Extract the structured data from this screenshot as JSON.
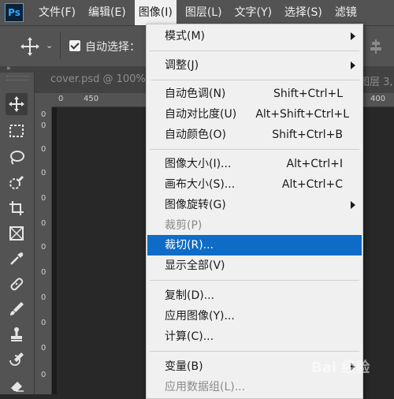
{
  "app": {
    "logo": "Ps"
  },
  "menubar": {
    "items": [
      {
        "label": "文件(F)"
      },
      {
        "label": "编辑(E)"
      },
      {
        "label": "图像(I)"
      },
      {
        "label": "图层(L)"
      },
      {
        "label": "文字(Y)"
      },
      {
        "label": "选择(S)"
      },
      {
        "label": "滤镜"
      }
    ]
  },
  "options": {
    "auto_select_label": "自动选择："
  },
  "document": {
    "tab_label": "cover.psd @ 100%",
    "tab_right_label": "图层 3,",
    "ruler_top": [
      "0",
      "450",
      "400"
    ],
    "ruler_left": [
      "0",
      "0",
      "0",
      "0",
      "0",
      "0",
      "0",
      "0",
      "0",
      "0",
      "0",
      "0"
    ]
  },
  "image_menu": {
    "items": [
      {
        "label": "模式(M)",
        "shortcut": ""
      },
      {
        "label": "调整(J)",
        "shortcut": ""
      },
      {
        "label": "自动色调(N)",
        "shortcut": "Shift+Ctrl+L"
      },
      {
        "label": "自动对比度(U)",
        "shortcut": "Alt+Shift+Ctrl+L"
      },
      {
        "label": "自动颜色(O)",
        "shortcut": "Shift+Ctrl+B"
      },
      {
        "label": "图像大小(I)...",
        "shortcut": "Alt+Ctrl+I"
      },
      {
        "label": "画布大小(S)...",
        "shortcut": "Alt+Ctrl+C"
      },
      {
        "label": "图像旋转(G)",
        "shortcut": ""
      },
      {
        "label": "裁剪(P)",
        "shortcut": ""
      },
      {
        "label": "裁切(R)...",
        "shortcut": ""
      },
      {
        "label": "显示全部(V)",
        "shortcut": ""
      },
      {
        "label": "复制(D)...",
        "shortcut": ""
      },
      {
        "label": "应用图像(Y)...",
        "shortcut": ""
      },
      {
        "label": "计算(C)...",
        "shortcut": ""
      },
      {
        "label": "变量(B)",
        "shortcut": ""
      },
      {
        "label": "应用数据组(L)...",
        "shortcut": ""
      }
    ],
    "highlighted_index": 9
  },
  "watermark": {
    "text": "Bai 经验"
  },
  "colors": {
    "menubar_bg": "#535353",
    "menu_bg": "#f0f0f0",
    "highlight": "#0e6cc7",
    "ps_blue": "#31a8ff"
  }
}
